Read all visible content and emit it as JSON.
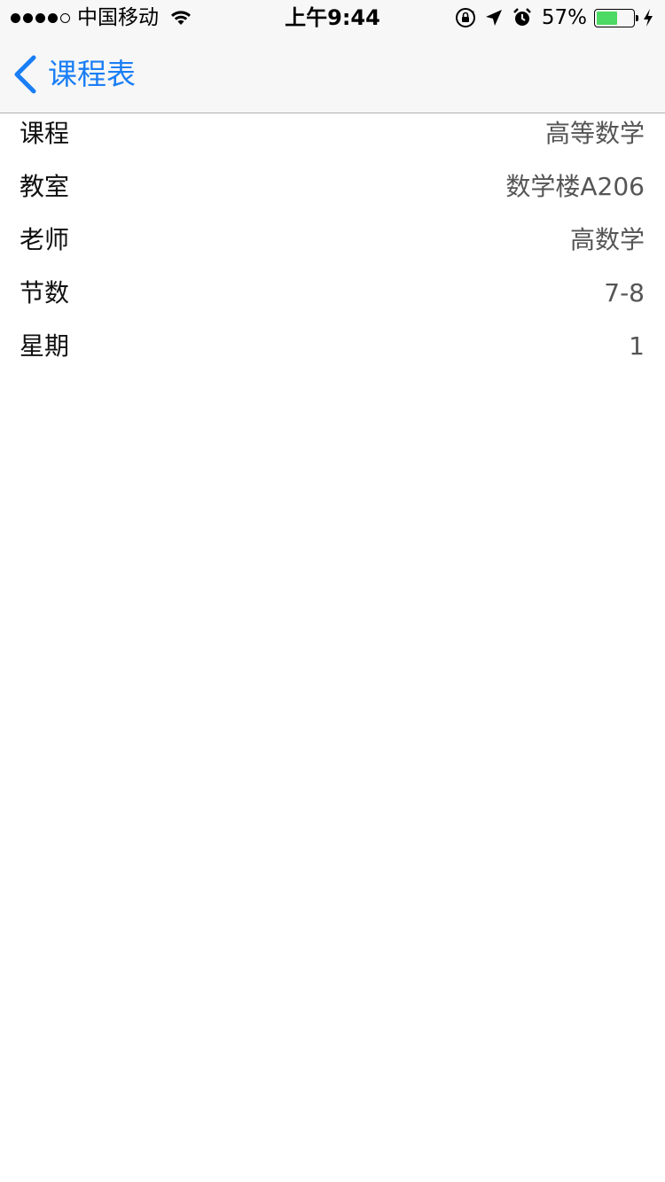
{
  "status_bar": {
    "carrier": "中国移动",
    "time": "上午9:44",
    "battery_percent": "57%",
    "battery_level": 0.57,
    "signal_bars_filled": 4,
    "signal_bars_total": 5,
    "icons": [
      "wifi-icon",
      "orientation-lock-icon",
      "location-arrow-icon",
      "alarm-icon",
      "battery-icon",
      "charging-bolt-icon"
    ]
  },
  "nav": {
    "back_label": "课程表",
    "accent_color": "#1a7ef5"
  },
  "details": [
    {
      "label": "课程",
      "value": "高等数学"
    },
    {
      "label": "教室",
      "value": "数学楼A206"
    },
    {
      "label": "老师",
      "value": "高数学"
    },
    {
      "label": "节数",
      "value": "7-8"
    },
    {
      "label": "星期",
      "value": "1"
    }
  ]
}
